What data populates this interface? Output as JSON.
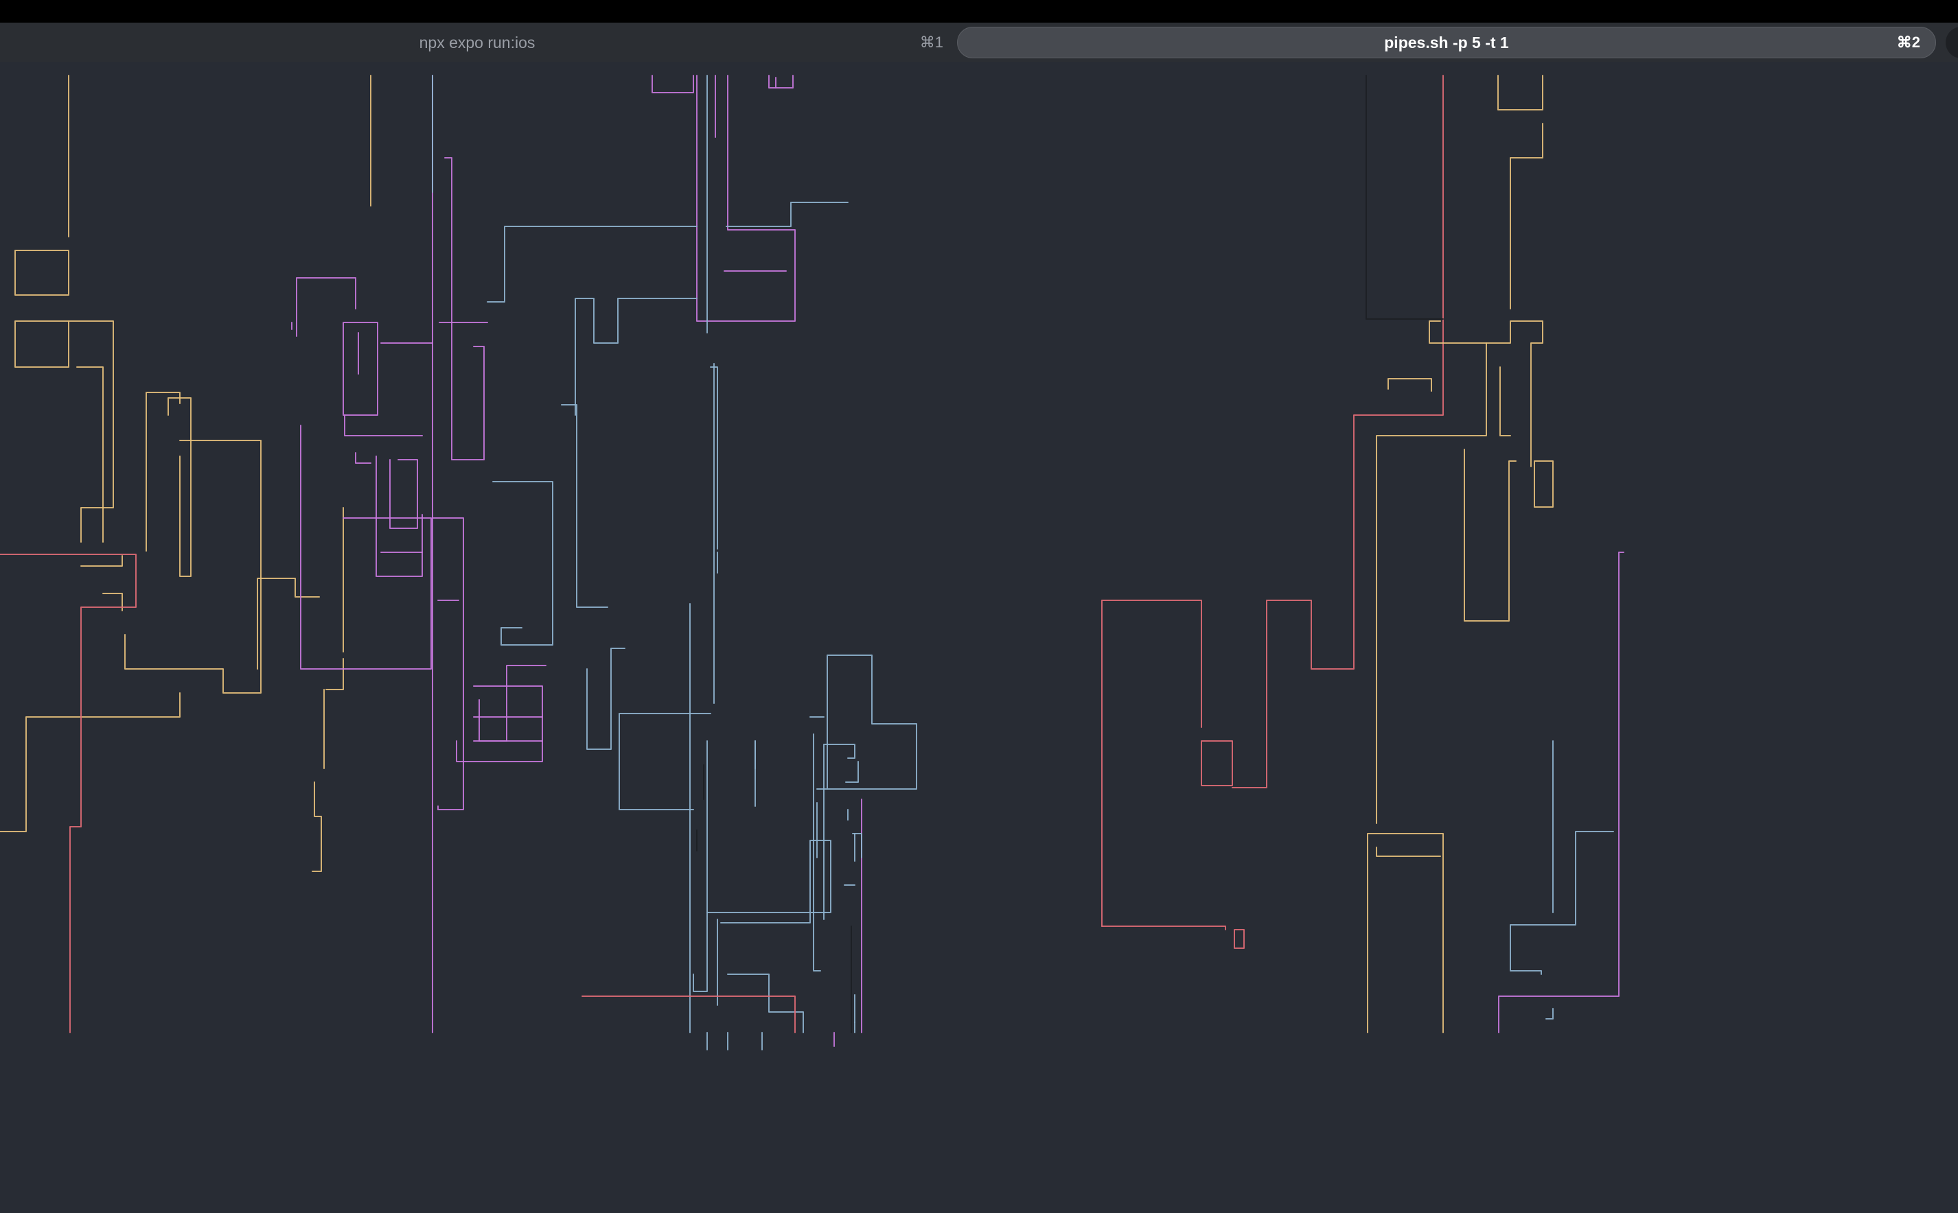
{
  "tabs": [
    {
      "title": "npx expo run:ios",
      "shortcut": "⌘1",
      "active": false
    },
    {
      "title": "pipes.sh -p 5 -t 1",
      "shortcut": "⌘2",
      "active": true
    }
  ],
  "colors": {
    "background": "#282c34",
    "tab_bar": "#2b2e33",
    "active_tab": "#474a50",
    "pipe_yellow": "#e5c07b",
    "pipe_purple": "#c678dd",
    "pipe_blue": "#8fb4cf",
    "pipe_red": "#e06c75",
    "pipe_dark": "#1c1f24"
  }
}
